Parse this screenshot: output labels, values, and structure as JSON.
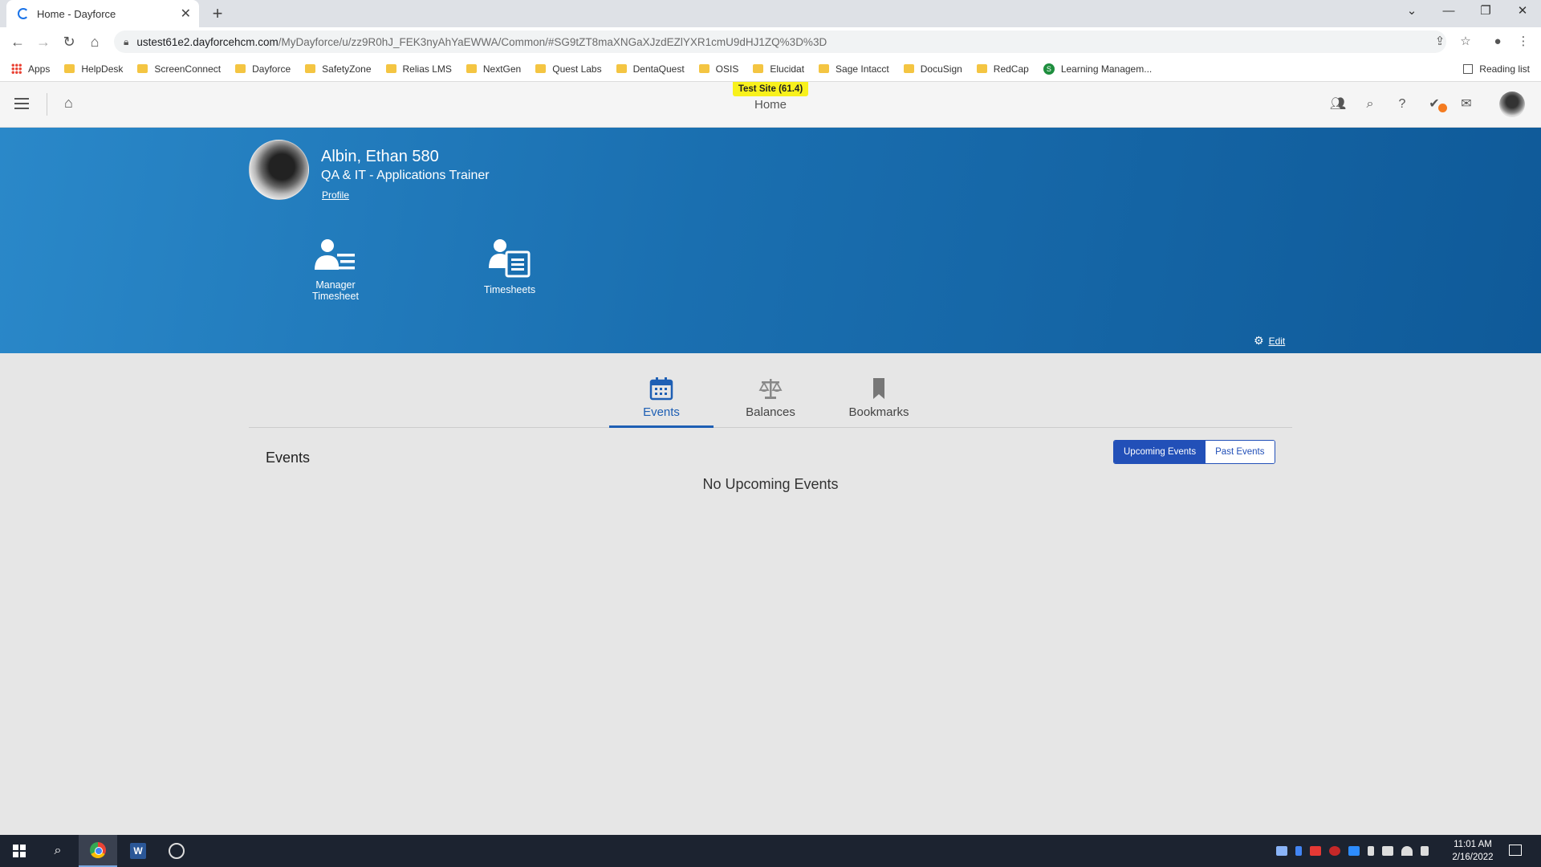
{
  "browser": {
    "tab_title": "Home - Dayforce",
    "url_host": "ustest61e2.dayforcehcm.com",
    "url_path": "/MyDayforce/u/zz9R0hJ_FEK3nyAhYaEWWA/Common/#SG9tZT8maXNGaXJzdEZlYXR1cmU9dHJ1ZQ%3D%3D",
    "bookmarks": [
      {
        "label": "Apps",
        "icon": "apps-grid-icon"
      },
      {
        "label": "HelpDesk",
        "icon": "folder-icon"
      },
      {
        "label": "ScreenConnect",
        "icon": "folder-icon"
      },
      {
        "label": "Dayforce",
        "icon": "folder-icon"
      },
      {
        "label": "SafetyZone",
        "icon": "folder-icon"
      },
      {
        "label": "Relias LMS",
        "icon": "folder-icon"
      },
      {
        "label": "NextGen",
        "icon": "folder-icon"
      },
      {
        "label": "Quest Labs",
        "icon": "folder-icon"
      },
      {
        "label": "DentaQuest",
        "icon": "folder-icon"
      },
      {
        "label": "OSIS",
        "icon": "folder-icon"
      },
      {
        "label": "Elucidat",
        "icon": "folder-icon"
      },
      {
        "label": "Sage Intacct",
        "icon": "folder-icon"
      },
      {
        "label": "DocuSign",
        "icon": "folder-icon"
      },
      {
        "label": "RedCap",
        "icon": "folder-icon"
      },
      {
        "label": "Learning Managem...",
        "icon": "sharepoint-icon"
      }
    ],
    "reading_list": "Reading list"
  },
  "header": {
    "badge": "Test Site (61.4)",
    "title": "Home"
  },
  "profile": {
    "name": "Albin, Ethan 580",
    "job_title": "QA & IT - Applications Trainer",
    "profile_link": "Profile"
  },
  "tiles": [
    {
      "label_line1": "Manager",
      "label_line2": "Timesheet"
    },
    {
      "label_line1": "Timesheets",
      "label_line2": ""
    }
  ],
  "edit_label": "Edit",
  "tabs": [
    {
      "label": "Events",
      "icon": "calendar-icon",
      "active": true
    },
    {
      "label": "Balances",
      "icon": "scales-icon",
      "active": false
    },
    {
      "label": "Bookmarks",
      "icon": "bookmark-icon",
      "active": false
    }
  ],
  "events": {
    "heading": "Events",
    "toggle_upcoming": "Upcoming Events",
    "toggle_past": "Past Events",
    "empty_message": "No Upcoming Events"
  },
  "taskbar": {
    "time": "11:01 AM",
    "date": "2/16/2022"
  },
  "colors": {
    "accent": "#2250b8",
    "banner_start": "#2a88c9",
    "banner_end": "#0f5a99",
    "badge": "#f8f11c",
    "notification": "#f47b20"
  }
}
